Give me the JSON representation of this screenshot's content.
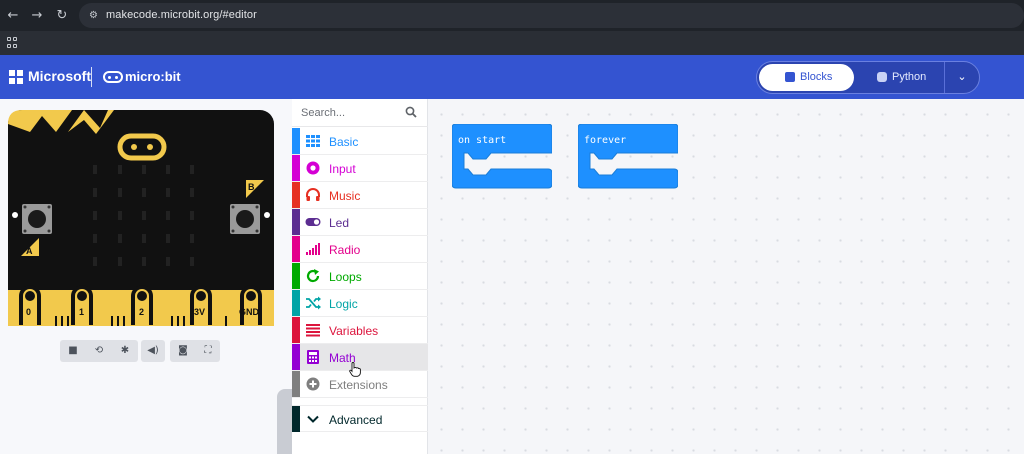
{
  "browser": {
    "url": "makecode.microbit.org/#editor",
    "back_icon": "arrow-left-icon",
    "forward_icon": "arrow-right-icon",
    "reload_icon": "reload-icon"
  },
  "header": {
    "brand": "Microsoft",
    "product": "micro:bit",
    "editor_toggle": {
      "blocks_label": "Blocks",
      "python_label": "Python",
      "selected": "Blocks"
    },
    "colors": {
      "header_bg": "#3454d1"
    }
  },
  "simulator": {
    "board_color": "#111111",
    "accent_color": "#f2c94c",
    "button_a_label": "A",
    "button_b_label": "B",
    "pins": [
      "0",
      "1",
      "2",
      "3V",
      "GND"
    ],
    "controls": [
      "stop-icon",
      "restart-icon",
      "debug-icon",
      "mute-icon",
      "screenshot-icon",
      "fullscreen-icon"
    ]
  },
  "toolbox": {
    "search_placeholder": "Search...",
    "categories": [
      {
        "label": "Basic",
        "color": "#1e90ff",
        "icon": "grid-icon"
      },
      {
        "label": "Input",
        "color": "#d400d4",
        "icon": "input-icon"
      },
      {
        "label": "Music",
        "color": "#e63022",
        "icon": "headphones-icon"
      },
      {
        "label": "Led",
        "color": "#5c2d91",
        "icon": "toggle-icon"
      },
      {
        "label": "Radio",
        "color": "#e3008c",
        "icon": "signal-icon"
      },
      {
        "label": "Loops",
        "color": "#00aa00",
        "icon": "loop-icon"
      },
      {
        "label": "Logic",
        "color": "#00a4a6",
        "icon": "shuffle-icon"
      },
      {
        "label": "Variables",
        "color": "#dc143c",
        "icon": "list-icon"
      },
      {
        "label": "Math",
        "color": "#9400d3",
        "icon": "calculator-icon"
      },
      {
        "label": "Extensions",
        "color": "#7f7f7f",
        "icon": "plus-circle-icon"
      },
      {
        "label": "Advanced",
        "color": "#00272b",
        "icon": "chevron-down-icon"
      }
    ],
    "hovered": "Math"
  },
  "workspace": {
    "block_color": "#1e90ff",
    "blocks": [
      {
        "label": "on start"
      },
      {
        "label": "forever"
      }
    ]
  }
}
